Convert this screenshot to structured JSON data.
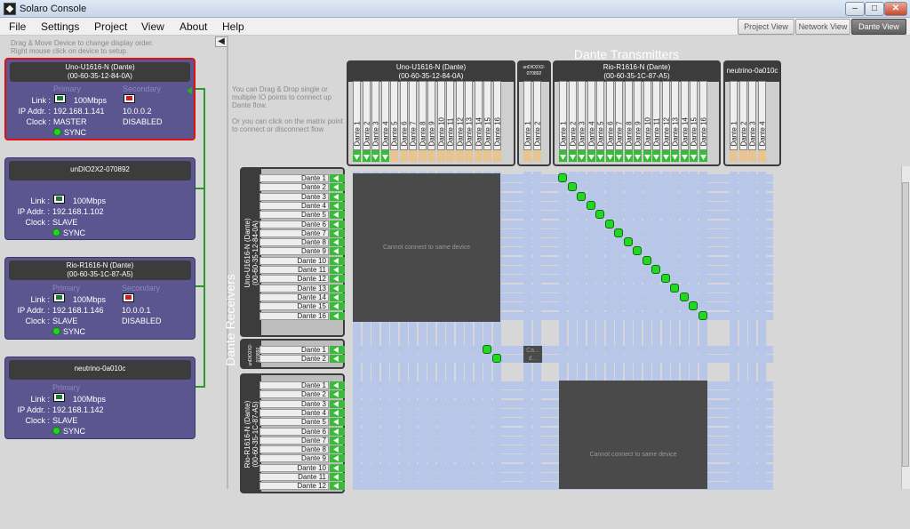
{
  "window": {
    "title": "Solaro Console",
    "min": "–",
    "max": "□",
    "close": "✕"
  },
  "menu": [
    "File",
    "Settings",
    "Project",
    "View",
    "About",
    "Help"
  ],
  "views": {
    "project": "Project View",
    "network": "Network View",
    "dante": "Dante View",
    "active": "Dante View"
  },
  "hint": {
    "line1": "Drag & Move Device to change display order.",
    "line2": "Right mouse click on device to setup."
  },
  "collapse_arrow": "◀",
  "devices": [
    {
      "name_line1": "Uno-U1616-N (Dante)",
      "name_line2": "(00-60-35-12-84-0A)",
      "selected": true,
      "primary": "Primary",
      "secondary": "Secondary",
      "link_label": "Link :",
      "link_speed": "100Mbps",
      "ip_label": "IP Addr. :",
      "ip_primary": "192.168.1.141",
      "ip_secondary": "10.0.0.2",
      "clock_label": "Clock :",
      "clock": "MASTER",
      "secondary_state": "DISABLED",
      "sync": "SYNC"
    },
    {
      "name_line1": "unDIO2X2-070892",
      "name_line2": "",
      "link_label": "Link :",
      "link_speed": "100Mbps",
      "ip_label": "IP Addr. :",
      "ip_primary": "192.168.1.102",
      "clock_label": "Clock :",
      "clock": "SLAVE",
      "sync": "SYNC"
    },
    {
      "name_line1": "Rio-R1616-N (Dante)",
      "name_line2": "(00-60-35-1C-87-A5)",
      "primary": "Primary",
      "secondary": "Secondary",
      "link_label": "Link :",
      "link_speed": "100Mbps",
      "ip_label": "IP Addr. :",
      "ip_primary": "192.168.1.146",
      "ip_secondary": "10.0.0.1",
      "clock_label": "Clock :",
      "clock": "SLAVE",
      "secondary_state": "DISABLED",
      "sync": "SYNC"
    },
    {
      "name_line1": "neutrino-0a010c",
      "name_line2": "",
      "primary": "Primary",
      "link_label": "Link :",
      "link_speed": "100Mbps",
      "ip_label": "IP Addr. :",
      "ip_primary": "192.168.1.142",
      "clock_label": "Clock :",
      "clock": "SLAVE",
      "sync": "SYNC"
    }
  ],
  "matrix": {
    "hint_line1": "You can Drag & Drop single or multiple IO points to connect up Dante flow.",
    "hint_line2": "Or you can click on the matrix point to connect or disconnect flow",
    "transmitters_title": "Dante Transmitters",
    "receivers_title": "Dante Receivers",
    "same_device_text": "Cannot connect to same device",
    "small_box_text": "Ca...\nd...",
    "tx_groups": [
      {
        "name_line1": "Uno-U1616-N (Dante)",
        "name_line2": "(00-60-35-12-84-0A)",
        "channels": 16,
        "green": 4
      },
      {
        "name_line1": "unDIO2X2-",
        "name_line2": "070892",
        "channels": 2,
        "green": 0
      },
      {
        "name_line1": "Rio-R1616-N (Dante)",
        "name_line2": "(00-60-35-1C-87-A5)",
        "channels": 16,
        "green": 16
      },
      {
        "name_line1": "neutrino-0a010c",
        "name_line2": "",
        "channels": 4,
        "green": 0
      }
    ],
    "rx_groups": [
      {
        "name_line1": "Uno-U1616-N (Dante)",
        "name_line2": "(00-60-35-12-84-0A)"
      },
      {
        "name_line1": "unDIO2X2-",
        "name_line2": "070892"
      },
      {
        "name_line1": "Rio-R1616-N (Dante)",
        "name_line2": "(00-60-35-1C-87-A5)"
      }
    ],
    "channel_label": "Dante",
    "rx_channels_uno": [
      "Dante 1",
      "Dante 2",
      "Dante 3",
      "Dante 4",
      "Dante 5",
      "Dante 6",
      "Dante 7",
      "Dante 8",
      "Dante 9",
      "Dante 10",
      "Dante 11",
      "Dante 12",
      "Dante 13",
      "Dante 14",
      "Dante 15",
      "Dante 16"
    ],
    "rx_channels_undio": [
      "Dante 1",
      "Dante 2"
    ],
    "rx_channels_rio": [
      "Dante 1",
      "Dante 2",
      "Dante 3",
      "Dante 4",
      "Dante 5",
      "Dante 6",
      "Dante 7",
      "Dante 8",
      "Dante 9",
      "Dante 10",
      "Dante 11",
      "Dante 12"
    ],
    "connections_note": "Rio Dante 1-16 to Uno Dante 1-16; Uno Dante 15-16 to unDIO Dante 1-2"
  },
  "colors": {
    "accent_green": "#22d822",
    "card_bg": "#5b5690",
    "tan": "#e8c590",
    "matrix_blue": "#b8c6e8"
  }
}
